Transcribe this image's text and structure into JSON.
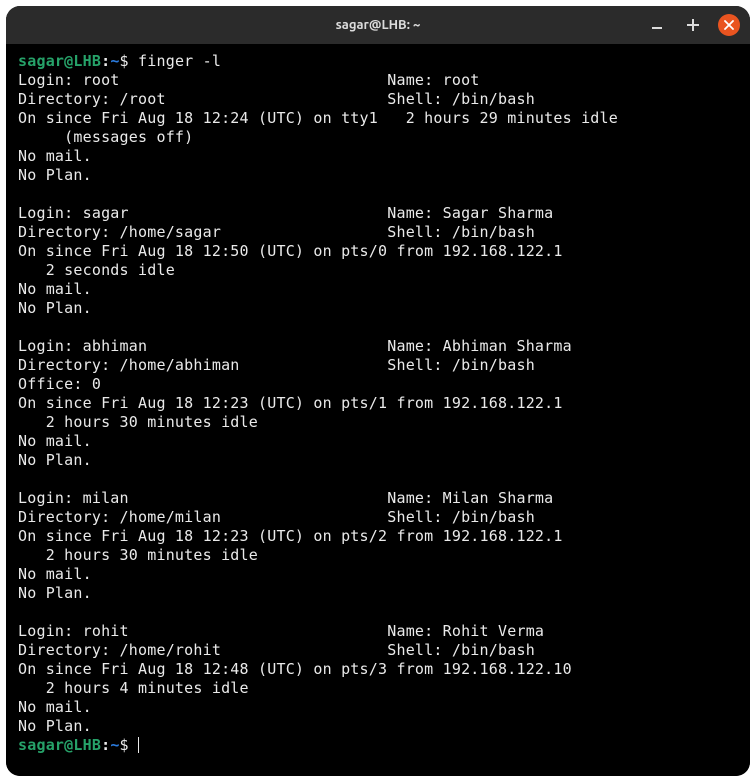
{
  "window": {
    "title": "sagar@LHB: ~"
  },
  "prompt": {
    "user_host": "sagar@LHB",
    "path": "~",
    "symbol": "$"
  },
  "command": "finger -l",
  "users": [
    {
      "login": "root",
      "name": "root",
      "directory": "/root",
      "shell": "/bin/bash",
      "on_since": "On since Fri Aug 18 12:24 (UTC) on tty1   2 hours 29 minutes idle",
      "extra_line": "     (messages off)",
      "idle_line": null,
      "office_line": null,
      "mail": "No mail.",
      "plan": "No Plan."
    },
    {
      "login": "sagar",
      "name": "Sagar Sharma",
      "directory": "/home/sagar",
      "shell": "/bin/bash",
      "on_since": "On since Fri Aug 18 12:50 (UTC) on pts/0 from 192.168.122.1",
      "extra_line": null,
      "idle_line": "   2 seconds idle",
      "office_line": null,
      "mail": "No mail.",
      "plan": "No Plan."
    },
    {
      "login": "abhiman",
      "name": "Abhiman Sharma",
      "directory": "/home/abhiman",
      "shell": "/bin/bash",
      "on_since": "On since Fri Aug 18 12:23 (UTC) on pts/1 from 192.168.122.1",
      "extra_line": null,
      "idle_line": "   2 hours 30 minutes idle",
      "office_line": "Office: 0",
      "mail": "No mail.",
      "plan": "No Plan."
    },
    {
      "login": "milan",
      "name": "Milan Sharma",
      "directory": "/home/milan",
      "shell": "/bin/bash",
      "on_since": "On since Fri Aug 18 12:23 (UTC) on pts/2 from 192.168.122.1",
      "extra_line": null,
      "idle_line": "   2 hours 30 minutes idle",
      "office_line": null,
      "mail": "No mail.",
      "plan": "No Plan."
    },
    {
      "login": "rohit",
      "name": "Rohit Verma",
      "directory": "/home/rohit",
      "shell": "/bin/bash",
      "on_since": "On since Fri Aug 18 12:48 (UTC) on pts/3 from 192.168.122.10",
      "extra_line": null,
      "idle_line": "   2 hours 4 minutes idle",
      "office_line": null,
      "mail": "No mail.",
      "plan": "No Plan."
    }
  ],
  "labels": {
    "login": "Login:",
    "name": "Name:",
    "directory": "Directory:",
    "shell": "Shell:"
  }
}
